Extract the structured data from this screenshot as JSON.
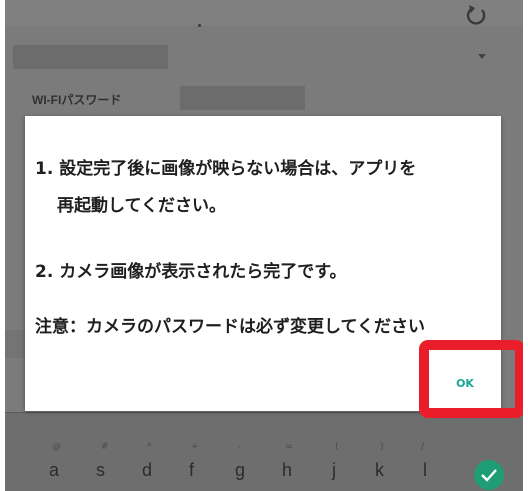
{
  "background": {
    "wifi_password_label": "WI-FIパスワード"
  },
  "dialog": {
    "message_1_number": "1.",
    "message_1_line1": "設定完了後に画像が映らない場合は、アプリを",
    "message_1_line2": "再起動してください。",
    "message_2_number": "2.",
    "message_2": "カメラ画像が表示されたら完了です。",
    "note": "注意：カメラのパスワードは必ず変更してください",
    "ok_label": "OK"
  },
  "keyboard": {
    "symbols": [
      "@",
      "#",
      "*",
      "+",
      "-",
      "=",
      "(",
      ")",
      "/"
    ],
    "keys": [
      "a",
      "s",
      "d",
      "f",
      "g",
      "h",
      "j",
      "k",
      "l"
    ]
  },
  "colors": {
    "accent": "#1aa796",
    "highlight": "#ea1e2a",
    "enter": "#1f9e76"
  },
  "icons": [
    "refresh-icon",
    "dropdown-arrow-icon",
    "check-icon"
  ]
}
